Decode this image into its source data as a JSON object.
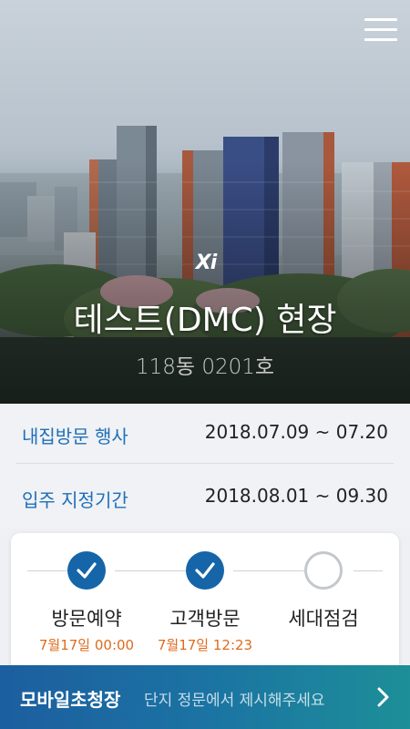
{
  "hero": {
    "brand": "Xi",
    "site_title": "테스트(DMC) 현장",
    "unit": "118동 0201호"
  },
  "info": [
    {
      "label": "내집방문 행사",
      "value": "2018.07.09 ~ 07.20"
    },
    {
      "label": "입주 지정기간",
      "value": "2018.08.01 ~ 09.30"
    }
  ],
  "steps": [
    {
      "label": "방문예약",
      "time": "7월17일 00:00",
      "status": "done"
    },
    {
      "label": "고객방문",
      "time": "7월17일 12:23",
      "status": "done"
    },
    {
      "label": "세대점검",
      "time": "",
      "status": "pending"
    }
  ],
  "bottom_bar": {
    "title": "모바일초청장",
    "subtitle": "단지 정문에서 제시해주세요"
  },
  "colors": {
    "primary": "#1565a8",
    "accent_time": "#e06a1b",
    "info_label": "#1f6fb8"
  }
}
